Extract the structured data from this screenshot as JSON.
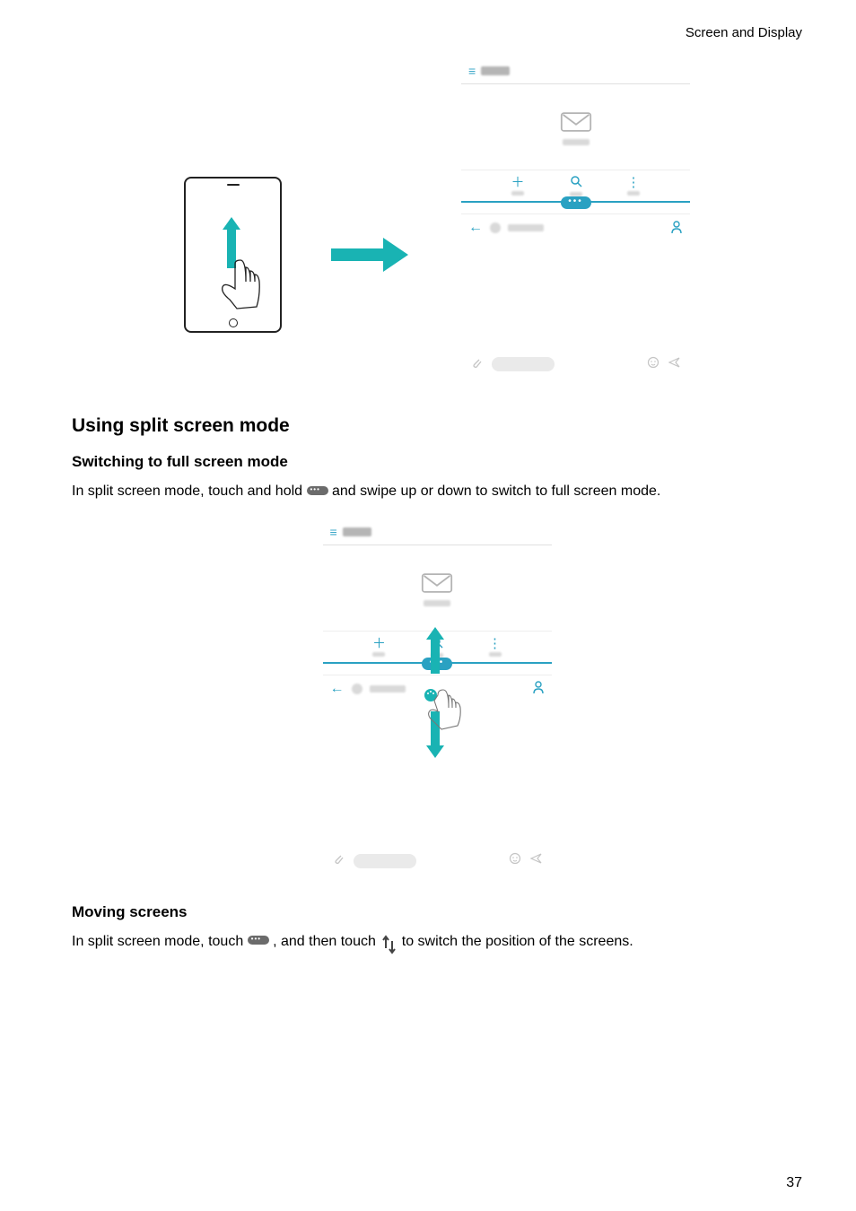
{
  "header": {
    "running_title": "Screen and Display"
  },
  "section1": {
    "heading": "Using split screen mode",
    "sub1": {
      "heading": "Switching to full screen mode",
      "para_before": "In split screen mode, touch and hold ",
      "para_after": " and swipe up or down to switch to full screen mode."
    },
    "sub2": {
      "heading": "Moving screens",
      "p_a": "In split screen mode, touch ",
      "p_b": " , and then touch ",
      "p_c": " to switch the position of the screens."
    }
  },
  "page_number": "37"
}
